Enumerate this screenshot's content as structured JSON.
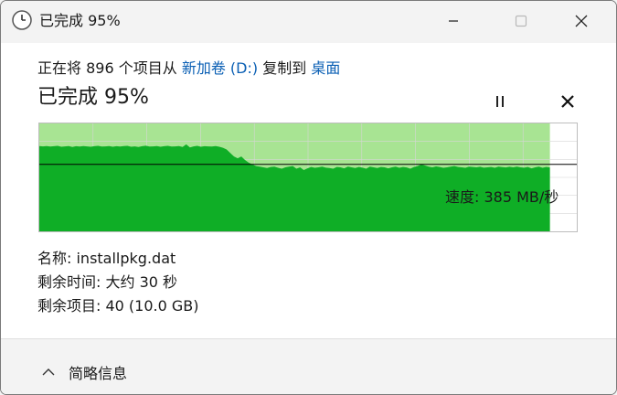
{
  "window": {
    "title": "已完成 95%",
    "controls": {
      "minimize_icon": "minimize-icon",
      "maximize_icon": "maximize-icon",
      "close_icon": "close-icon"
    }
  },
  "operation": {
    "prefix": "正在将 896 个项目从",
    "source": "新加卷 (D:)",
    "middle": "复制到",
    "destination": "桌面",
    "status_title": "已完成 95%",
    "progress_percent": 95
  },
  "speed": {
    "label": "速度: 385 MB/秒",
    "history_mb_per_s": [
      490,
      488,
      490,
      487,
      489,
      491,
      486,
      488,
      490,
      485,
      489,
      487,
      490,
      488,
      486,
      489,
      491,
      487,
      488,
      490,
      486,
      489,
      487,
      490,
      491,
      486,
      488,
      485,
      489,
      492,
      487,
      488,
      490,
      486,
      489,
      491,
      487,
      488,
      490,
      485,
      500,
      482,
      488,
      491,
      486,
      489,
      488,
      487,
      490,
      486,
      480,
      470,
      450,
      430,
      420,
      430,
      410,
      395,
      385,
      375,
      372,
      368,
      364,
      370,
      372,
      365,
      360,
      368,
      372,
      375,
      360,
      368,
      352,
      362,
      370,
      365,
      368,
      372,
      366,
      364,
      360,
      370,
      368,
      362,
      372,
      368,
      364,
      370,
      366,
      360,
      372,
      368,
      364,
      370,
      368,
      362,
      368,
      372,
      365,
      370,
      367,
      360,
      370,
      375,
      385,
      378,
      372,
      368,
      373,
      370,
      365,
      368,
      372,
      375,
      370,
      368,
      365,
      372,
      370,
      368,
      371,
      366,
      368,
      370,
      365,
      372,
      369,
      367,
      371,
      368,
      372,
      368,
      366,
      370,
      362,
      368,
      372,
      365,
      370,
      367
    ],
    "current_mb_per_s": 385,
    "max_mb_per_s": 620
  },
  "details": {
    "name": "名称: installpkg.dat",
    "time_remaining": "剩余时间: 大约 30 秒",
    "items_remaining": "剩余项目: 40 (10.0 GB)"
  },
  "footer": {
    "toggle_label": "简略信息",
    "icon": "chevron-up-icon"
  },
  "colors": {
    "fill_light": "#a8e493",
    "fill_dark": "#0fae26",
    "link": "#0a5fb4"
  }
}
